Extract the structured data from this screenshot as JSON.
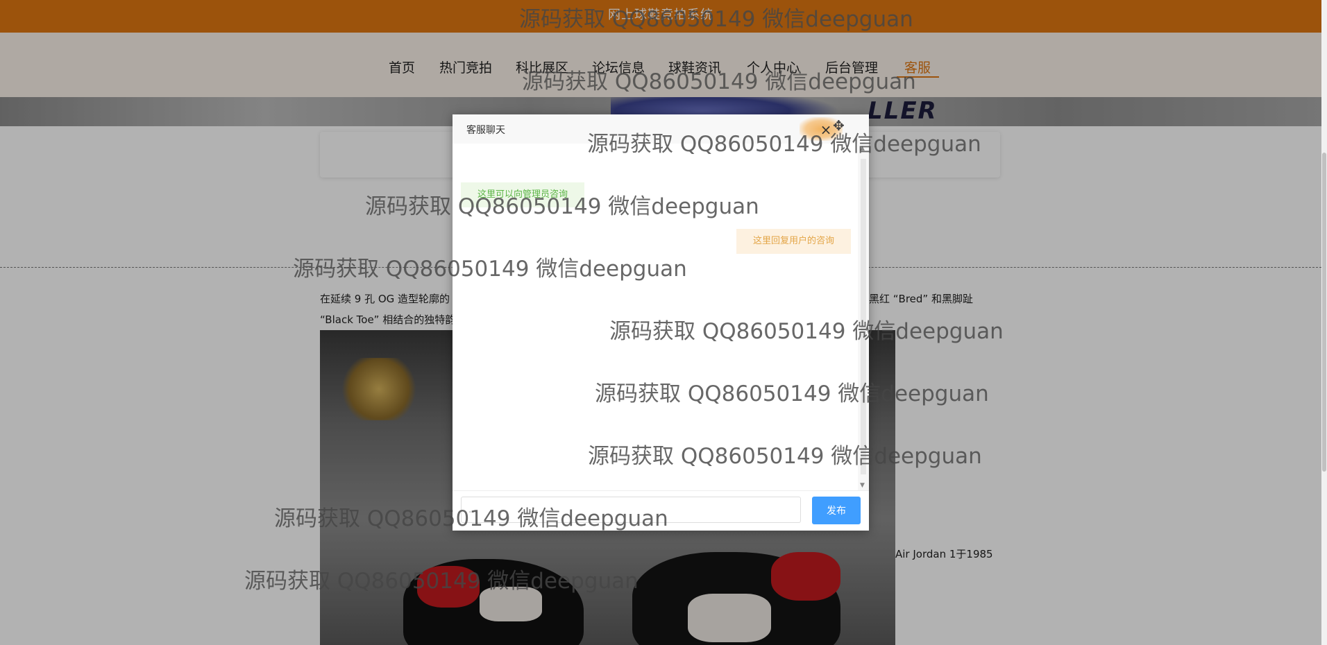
{
  "app": {
    "title": "网上球鞋竞拍系统"
  },
  "nav": {
    "items": [
      {
        "label": "首页"
      },
      {
        "label": "热门竞拍"
      },
      {
        "label": "科比展区"
      },
      {
        "label": "论坛信息"
      },
      {
        "label": "球鞋资讯"
      },
      {
        "label": "个人中心"
      },
      {
        "label": "后台管理"
      },
      {
        "label": "客服",
        "active": true
      }
    ]
  },
  "banner": {
    "logo_text": "LLER"
  },
  "article": {
    "line1": "在延续 9 孔 OG 造型轮廓的",
    "line1_right": "黑红 “Bred” 和黑脚趾",
    "line2": "“Black Toe” 相结合的独特韵",
    "side_text": "Air Jordan 1于1985"
  },
  "chat": {
    "title": "客服聊天",
    "close_glyph": "×",
    "move_glyph": "✥",
    "messages": [
      {
        "side": "left",
        "text": "这里可以向管理员咨询"
      },
      {
        "side": "right",
        "text": "这里回复用户的咨询"
      }
    ],
    "input_value": "",
    "input_placeholder": "...",
    "send_label": "发布",
    "scroll_up": "▲",
    "scroll_down": "▼"
  },
  "watermark": {
    "text": "源码获取 QQ86050149 微信deepguan"
  },
  "colors": {
    "topbar": "#e07712",
    "accent": "#e07712",
    "send_button": "#409eff",
    "admin_bubble_text": "#5bb545",
    "reply_bubble_text": "#e3a547"
  },
  "icons": {
    "close": "close-icon",
    "move": "move-icon"
  }
}
